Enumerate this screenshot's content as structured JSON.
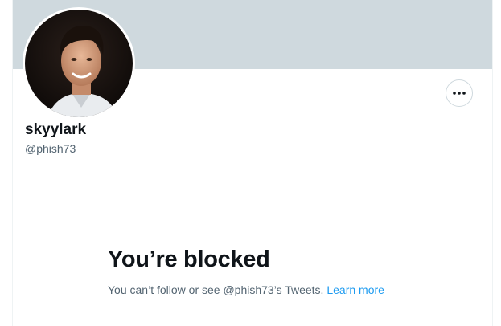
{
  "profile": {
    "display_name": "skyylark",
    "handle": "@phish73",
    "avatar_icon": "profile-photo",
    "more_icon": "more-dots-icon"
  },
  "blocked": {
    "title": "You’re blocked",
    "message": "You can’t follow or see @phish73’s Tweets.",
    "link_label": "Learn more"
  },
  "colors": {
    "banner": "#cfd9de",
    "link": "#1d9bf0",
    "primary_text": "#0f1419",
    "secondary_text": "#536471"
  }
}
